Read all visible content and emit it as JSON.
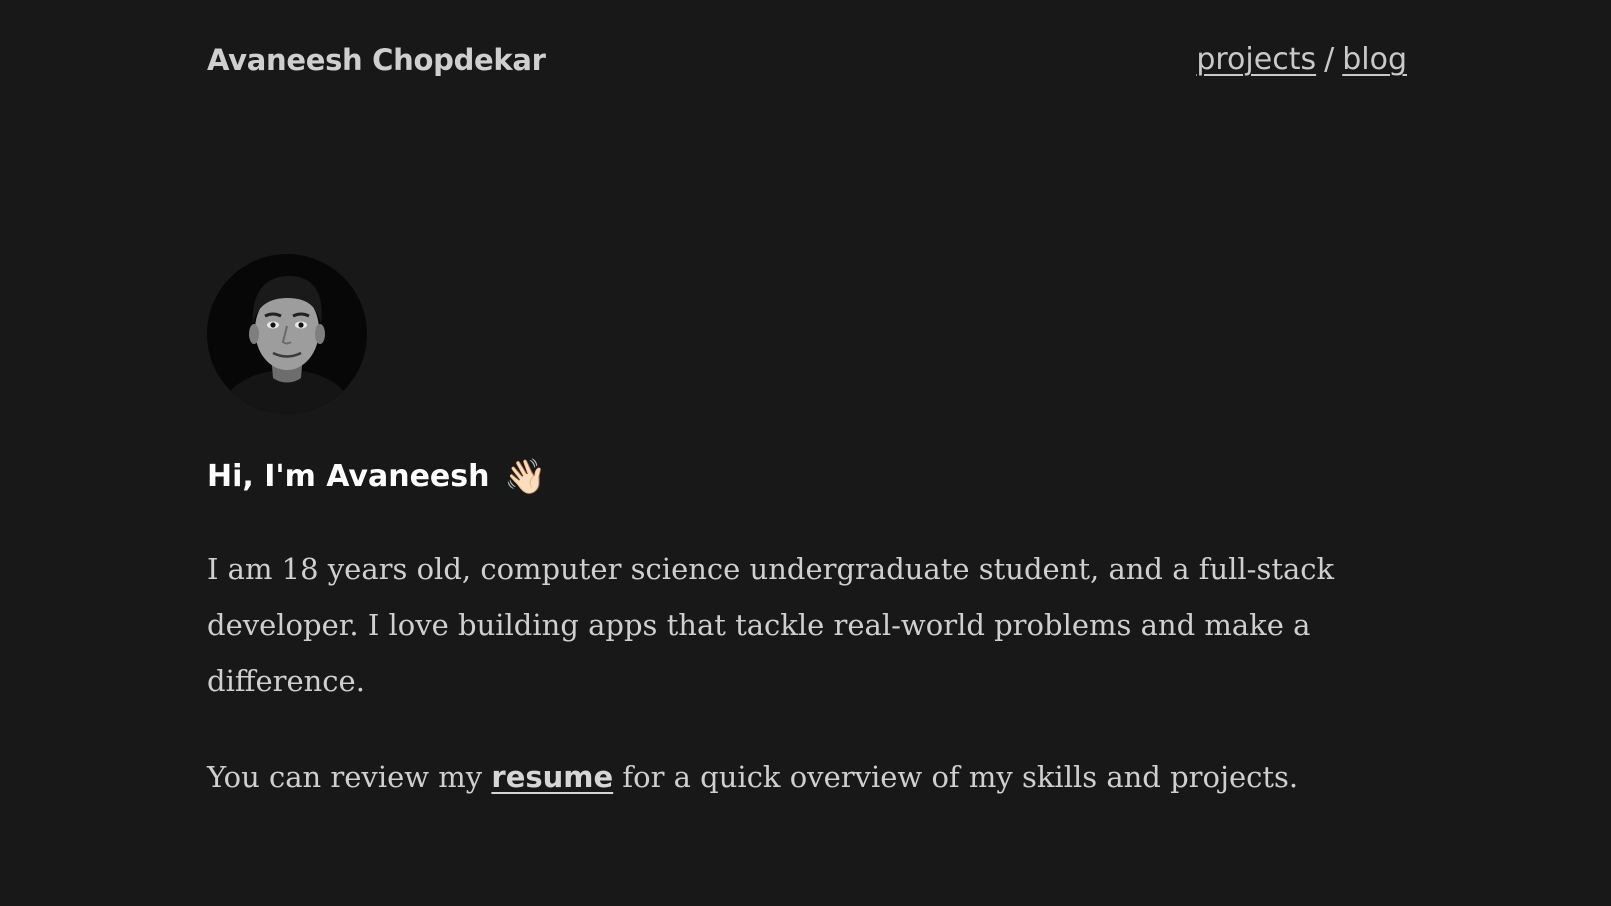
{
  "header": {
    "site_title": "Avaneesh Chopdekar",
    "nav": {
      "projects_label": "projects",
      "separator": "/",
      "blog_label": "blog"
    }
  },
  "profile": {
    "avatar_style": "grayscale portrait photo",
    "greeting": "Hi, I'm Avaneesh",
    "greeting_emoji": "👋🏻",
    "bio": "I am 18 years old, computer science undergraduate student, and a full-stack developer. I love building apps that tackle real-world problems and make a difference.",
    "resume_prefix": "You can review my ",
    "resume_link_label": "resume",
    "resume_suffix": " for a quick overview of my skills and projects."
  },
  "colors": {
    "background": "#181818",
    "text": "#cfcfcf",
    "heading": "#ffffff"
  }
}
